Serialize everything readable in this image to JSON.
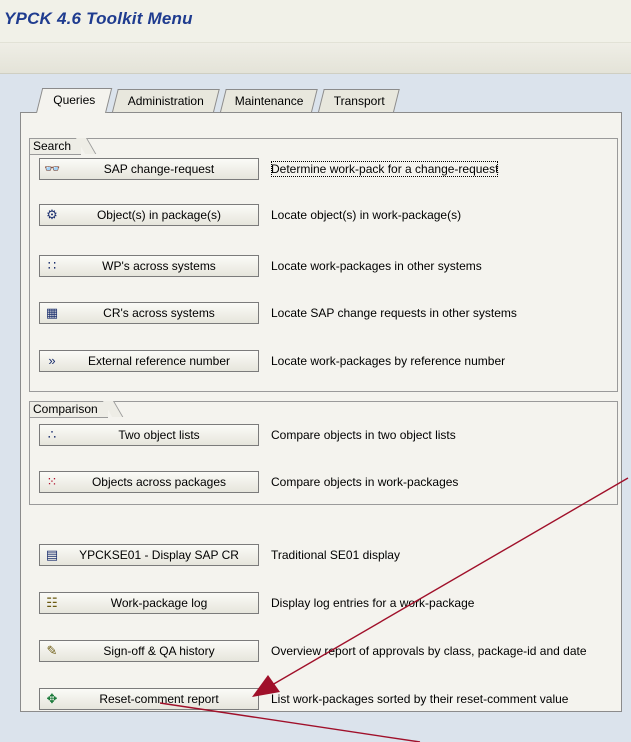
{
  "window": {
    "title": "YPCK 4.6 Toolkit Menu"
  },
  "tabs": [
    {
      "label": "Queries",
      "active": true
    },
    {
      "label": "Administration",
      "active": false
    },
    {
      "label": "Maintenance",
      "active": false
    },
    {
      "label": "Transport",
      "active": false
    }
  ],
  "groups": {
    "search": {
      "label": "Search",
      "rows": [
        {
          "icon": "binoculars-icon",
          "button": "SAP change-request",
          "desc": "Determine work-pack for a change-request"
        },
        {
          "icon": "gear-icon",
          "button": "Object(s) in package(s)",
          "desc": "Locate object(s) in work-package(s)"
        },
        {
          "icon": "network-icon",
          "button": "WP's across systems",
          "desc": "Locate work-packages in other systems"
        },
        {
          "icon": "grid-icon",
          "button": "CR's across systems",
          "desc": "Locate SAP change requests in other systems"
        },
        {
          "icon": "signal-icon",
          "button": "External reference number",
          "desc": "Locate work-packages by reference number"
        }
      ]
    },
    "comparison": {
      "label": "Comparison",
      "rows": [
        {
          "icon": "compare-icon",
          "button": "Two object lists",
          "desc": "Compare objects in two object lists"
        },
        {
          "icon": "matrix-icon",
          "button": "Objects across packages",
          "desc": "Compare objects in work-packages"
        }
      ]
    }
  },
  "other_rows": [
    {
      "icon": "document-icon",
      "button": "YPCKSE01 - Display SAP CR",
      "desc": "Traditional SE01 display"
    },
    {
      "icon": "log-icon",
      "button": "Work-package log",
      "desc": "Display log entries for a work-package"
    },
    {
      "icon": "signoff-icon",
      "button": "Sign-off & QA history",
      "desc": "Overview report of approvals by class, package-id and date"
    },
    {
      "icon": "report-icon",
      "button": "Reset-comment report",
      "desc": "List work-packages sorted by their reset-comment value"
    }
  ],
  "colors": {
    "title": "#1f3c8f",
    "workarea": "#dbe3ec",
    "panel": "#f4f3ee",
    "arrow": "#a0102a"
  }
}
